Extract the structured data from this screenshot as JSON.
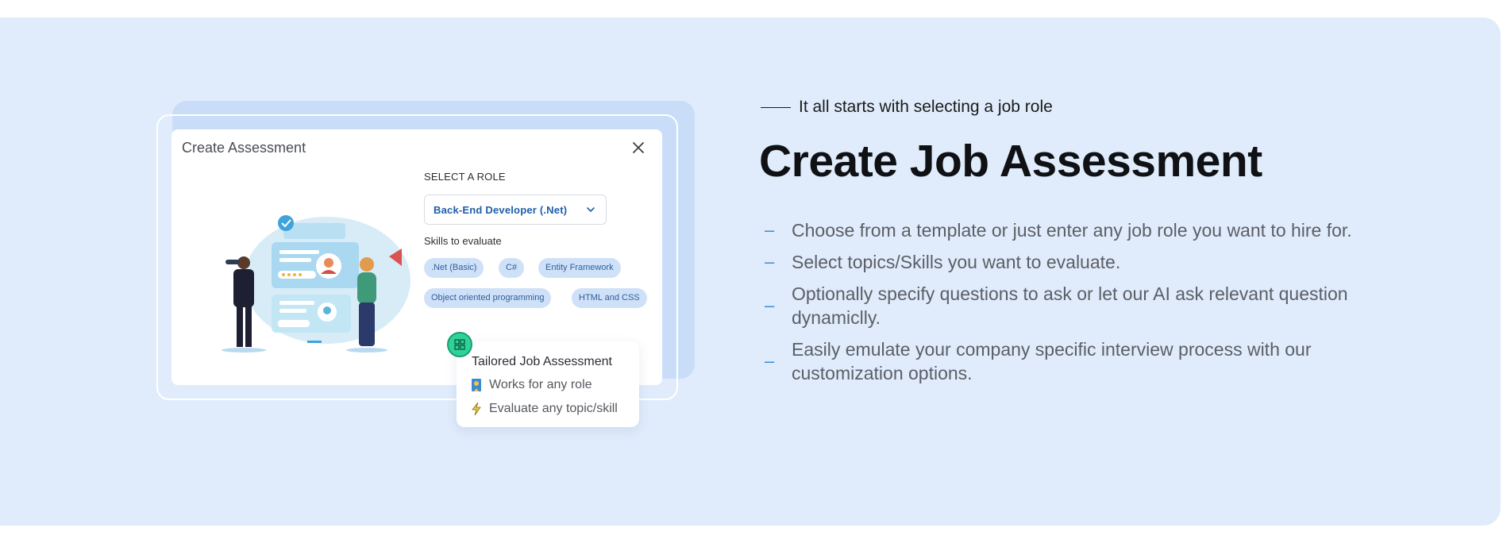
{
  "modal": {
    "title": "Create Assessment",
    "select_role_label": "SELECT A ROLE",
    "selected_role": "Back-End Developer (.Net)",
    "skills_label": "Skills to evaluate",
    "skills": [
      ".Net (Basic)",
      "C#",
      "Entity Framework",
      "Object oriented programming",
      "HTML and CSS"
    ]
  },
  "tooltip": {
    "title": "Tailored Job Assessment",
    "rows": [
      "Works for any role",
      "Evaluate any topic/skill"
    ]
  },
  "hero": {
    "eyebrow": "It all starts with selecting a job role",
    "headline": "Create Job Assessment",
    "bullets": [
      "Choose from a template or just enter any job role you want to hire for.",
      "Select topics/Skills you want to evaluate.",
      "Optionally specify questions to ask or let our AI ask relevant question dynamiclly.",
      "Easily emulate your company specific interview process with our customization options."
    ]
  },
  "colors": {
    "section_bg": "#e0ecfb",
    "accent": "#1f5ea8",
    "chip_bg": "#cfe1f8",
    "badge": "#2fd39a"
  }
}
